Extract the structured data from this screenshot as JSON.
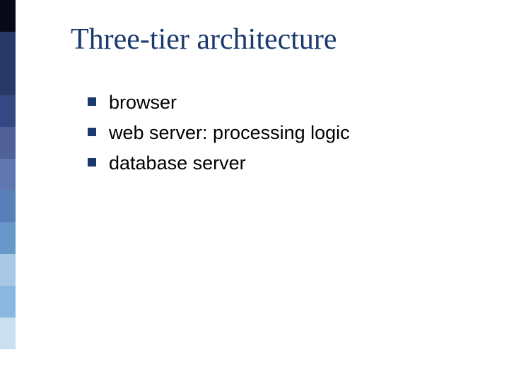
{
  "sidebar": {
    "colors": [
      "#080818",
      "#283868",
      "#283868",
      "#344884",
      "#506098",
      "#6078b0",
      "#5880b8",
      "#6898c8",
      "#a8c8e8",
      "#88b8e0",
      "#c8e0f0",
      "#ffffff"
    ]
  },
  "title": "Three-tier architecture",
  "bullets": [
    {
      "text": "browser"
    },
    {
      "text": "web server: processing logic"
    },
    {
      "text": "database server"
    }
  ]
}
